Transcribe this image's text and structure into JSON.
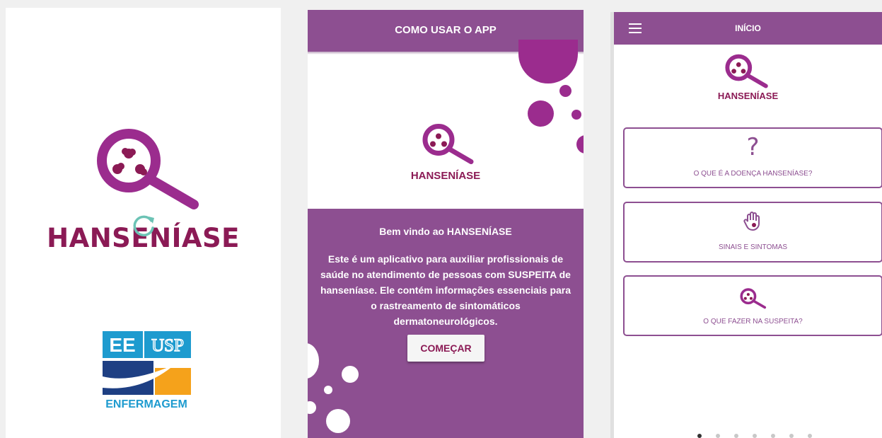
{
  "splash": {
    "brand": "HANSENÍASE",
    "partner_logo": {
      "ee": "EE",
      "usp": "USP",
      "enfermagem": "ENFERMAGEM"
    }
  },
  "intro": {
    "header_title": "COMO USAR O APP",
    "brand": "HANSENÍASE",
    "welcome": "Bem vindo ao HANSENÍASE",
    "description": "Este é um aplicativo para auxiliar profissionais de saúde no atendimento de pessoas com SUSPEITA de hanseníase. Ele contém informações essenciais para o rastreamento de sintomáticos dermatoneurológicos.",
    "start_button": "COMEÇAR"
  },
  "home": {
    "header_title": "INÍCIO",
    "brand": "HANSENÍASE",
    "cards": [
      {
        "icon": "question-icon",
        "glyph": "?",
        "label": "O QUE É A DOENÇA HANSENÍASE?"
      },
      {
        "icon": "hand-icon",
        "label": "SINAIS E SINTOMAS"
      },
      {
        "icon": "magnifier-icon",
        "label": "O QUE FAZER NA SUSPEITA?"
      }
    ],
    "page_indicator": {
      "pages": 7,
      "current": 1
    }
  },
  "colors": {
    "primary_purple": "#8d4f91",
    "brand_magenta": "#8b1a55",
    "logo_purple": "#9b2c8e",
    "spinner_teal": "#6cc3b5"
  }
}
